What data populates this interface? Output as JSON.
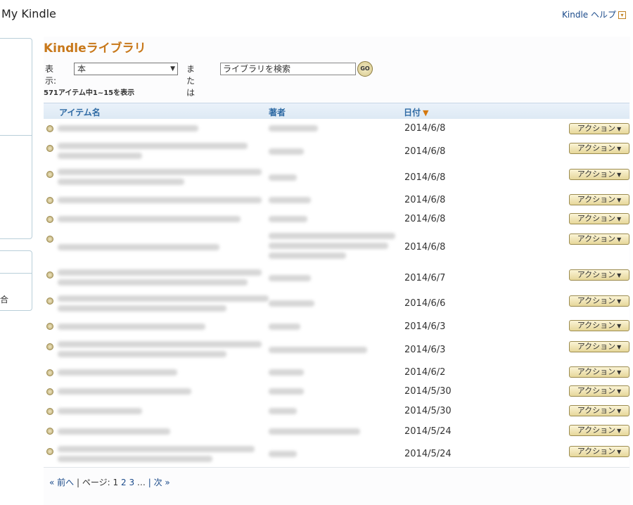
{
  "header": {
    "title": "My Kindle",
    "help_label": "Kindle ヘルプ"
  },
  "sidebar": {
    "partial_label": "合"
  },
  "library": {
    "title": "Kindleライブラリ",
    "show_label": "表示:",
    "show_value": "本",
    "or_label": "または",
    "search_placeholder": "ライブラリを検索",
    "go_label": "GO",
    "count_text": "571アイテム中1~15を表示"
  },
  "table": {
    "columns": {
      "title": "アイテム名",
      "author": "著者",
      "date": "日付"
    },
    "action_label": "アクション",
    "rows": [
      {
        "date": "2014/6/8"
      },
      {
        "date": "2014/6/8"
      },
      {
        "date": "2014/6/8"
      },
      {
        "date": "2014/6/8"
      },
      {
        "date": "2014/6/8"
      },
      {
        "date": "2014/6/8"
      },
      {
        "date": "2014/6/7"
      },
      {
        "date": "2014/6/6"
      },
      {
        "date": "2014/6/3"
      },
      {
        "date": "2014/6/3"
      },
      {
        "date": "2014/6/2"
      },
      {
        "date": "2014/5/30"
      },
      {
        "date": "2014/5/30"
      },
      {
        "date": "2014/5/24"
      },
      {
        "date": "2014/5/24"
      }
    ]
  },
  "pagination": {
    "prev": "« 前へ",
    "page_label": "| ページ:",
    "current": "1",
    "page2": "2",
    "page3": "3",
    "ellipsis": "…",
    "next": "| 次 »"
  }
}
